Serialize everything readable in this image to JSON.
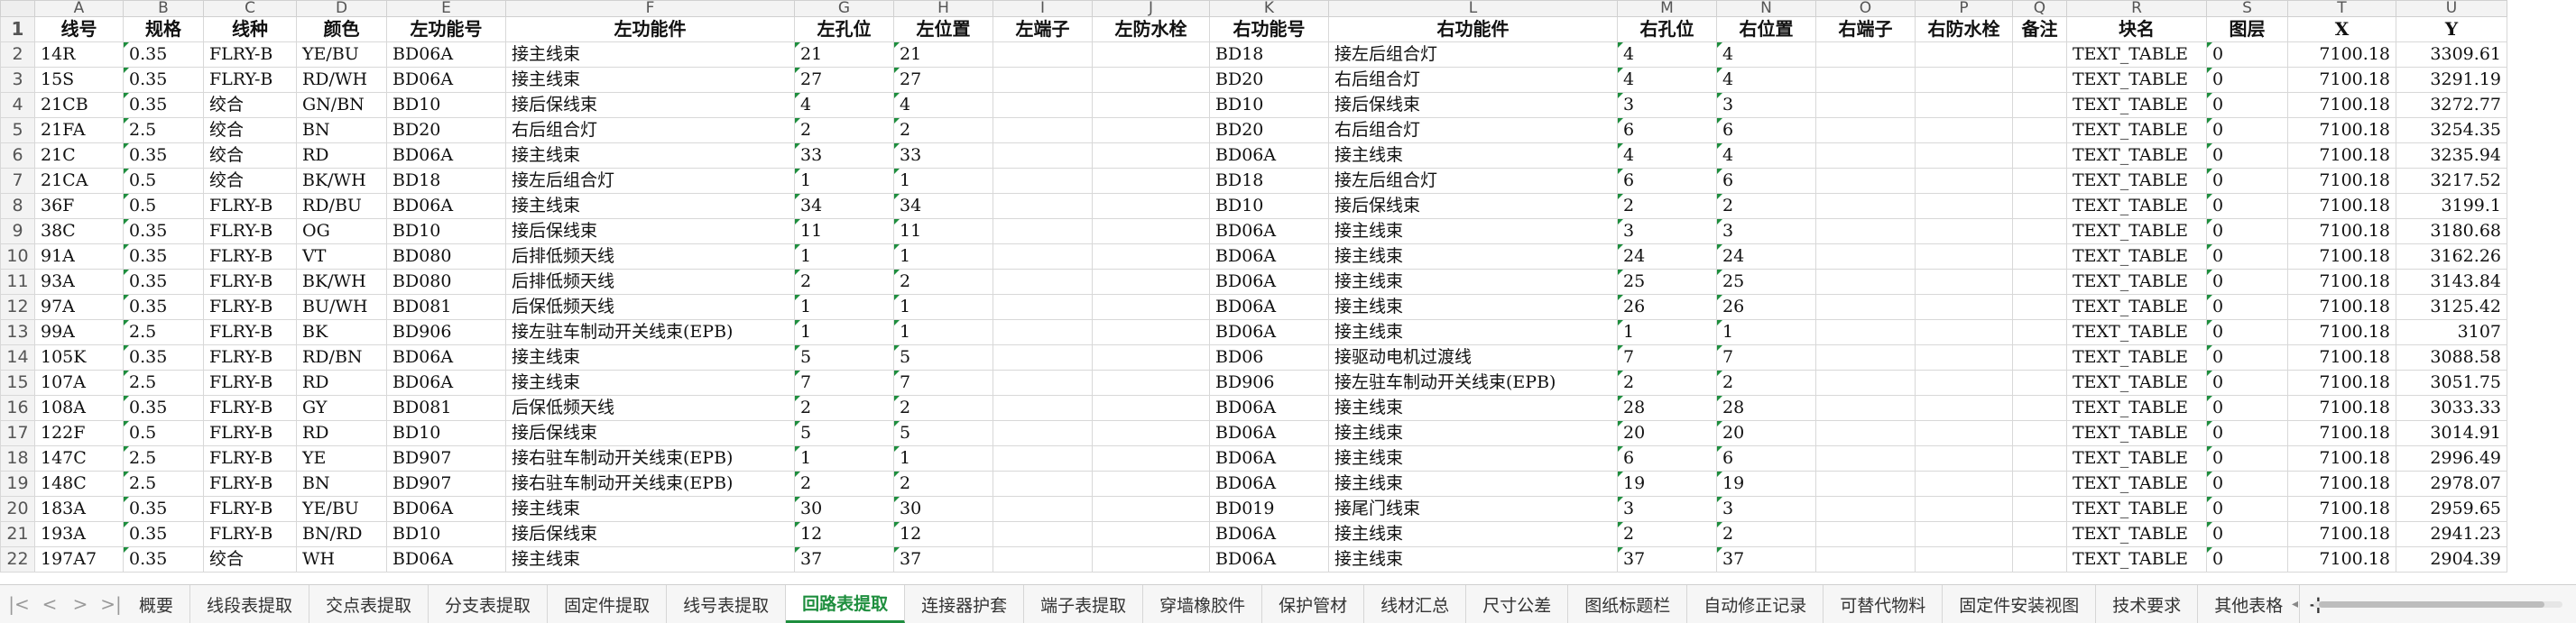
{
  "columns": [
    "A",
    "B",
    "C",
    "D",
    "E",
    "F",
    "G",
    "H",
    "I",
    "J",
    "K",
    "L",
    "M",
    "N",
    "O",
    "P",
    "Q",
    "R",
    "S",
    "T",
    "U"
  ],
  "headers": [
    "线号",
    "规格",
    "线种",
    "颜色",
    "左功能号",
    "左功能件",
    "左孔位",
    "左位置",
    "左端子",
    "左防水栓",
    "右功能号",
    "右功能件",
    "右孔位",
    "右位置",
    "右端子",
    "右防水栓",
    "备注",
    "块名",
    "图层",
    "X",
    "Y"
  ],
  "rows": [
    [
      "14R",
      "0.35",
      "FLRY-B",
      "YE/BU",
      "BD06A",
      "接主线束",
      "21",
      "21",
      "",
      "",
      "BD18",
      "接左后组合灯",
      "4",
      "4",
      "",
      "",
      "",
      "TEXT_TABLE",
      "0",
      "7100.18",
      "3309.61"
    ],
    [
      "15S",
      "0.35",
      "FLRY-B",
      "RD/WH",
      "BD06A",
      "接主线束",
      "27",
      "27",
      "",
      "",
      "BD20",
      "右后组合灯",
      "4",
      "4",
      "",
      "",
      "",
      "TEXT_TABLE",
      "0",
      "7100.18",
      "3291.19"
    ],
    [
      "21CB",
      "0.35",
      "绞合",
      "GN/BN",
      "BD10",
      "接后保线束",
      "4",
      "4",
      "",
      "",
      "BD10",
      "接后保线束",
      "3",
      "3",
      "",
      "",
      "",
      "TEXT_TABLE",
      "0",
      "7100.18",
      "3272.77"
    ],
    [
      "21FA",
      "2.5",
      "绞合",
      "BN",
      "BD20",
      "右后组合灯",
      "2",
      "2",
      "",
      "",
      "BD20",
      "右后组合灯",
      "6",
      "6",
      "",
      "",
      "",
      "TEXT_TABLE",
      "0",
      "7100.18",
      "3254.35"
    ],
    [
      "21C",
      "0.35",
      "绞合",
      "RD",
      "BD06A",
      "接主线束",
      "33",
      "33",
      "",
      "",
      "BD06A",
      "接主线束",
      "4",
      "4",
      "",
      "",
      "",
      "TEXT_TABLE",
      "0",
      "7100.18",
      "3235.94"
    ],
    [
      "21CA",
      "0.5",
      "绞合",
      "BK/WH",
      "BD18",
      "接左后组合灯",
      "1",
      "1",
      "",
      "",
      "BD18",
      "接左后组合灯",
      "6",
      "6",
      "",
      "",
      "",
      "TEXT_TABLE",
      "0",
      "7100.18",
      "3217.52"
    ],
    [
      "36F",
      "0.5",
      "FLRY-B",
      "RD/BU",
      "BD06A",
      "接主线束",
      "34",
      "34",
      "",
      "",
      "BD10",
      "接后保线束",
      "2",
      "2",
      "",
      "",
      "",
      "TEXT_TABLE",
      "0",
      "7100.18",
      "3199.1"
    ],
    [
      "38C",
      "0.35",
      "FLRY-B",
      "OG",
      "BD10",
      "接后保线束",
      "11",
      "11",
      "",
      "",
      "BD06A",
      "接主线束",
      "3",
      "3",
      "",
      "",
      "",
      "TEXT_TABLE",
      "0",
      "7100.18",
      "3180.68"
    ],
    [
      "91A",
      "0.35",
      "FLRY-B",
      "VT",
      "BD080",
      "后排低频天线",
      "1",
      "1",
      "",
      "",
      "BD06A",
      "接主线束",
      "24",
      "24",
      "",
      "",
      "",
      "TEXT_TABLE",
      "0",
      "7100.18",
      "3162.26"
    ],
    [
      "93A",
      "0.35",
      "FLRY-B",
      "BK/WH",
      "BD080",
      "后排低频天线",
      "2",
      "2",
      "",
      "",
      "BD06A",
      "接主线束",
      "25",
      "25",
      "",
      "",
      "",
      "TEXT_TABLE",
      "0",
      "7100.18",
      "3143.84"
    ],
    [
      "97A",
      "0.35",
      "FLRY-B",
      "BU/WH",
      "BD081",
      "后保低频天线",
      "1",
      "1",
      "",
      "",
      "BD06A",
      "接主线束",
      "26",
      "26",
      "",
      "",
      "",
      "TEXT_TABLE",
      "0",
      "7100.18",
      "3125.42"
    ],
    [
      "99A",
      "2.5",
      "FLRY-B",
      "BK",
      "BD906",
      "接左驻车制动开关线束(EPB)",
      "1",
      "1",
      "",
      "",
      "BD06A",
      "接主线束",
      "1",
      "1",
      "",
      "",
      "",
      "TEXT_TABLE",
      "0",
      "7100.18",
      "3107"
    ],
    [
      "105K",
      "0.35",
      "FLRY-B",
      "RD/BN",
      "BD06A",
      "接主线束",
      "5",
      "5",
      "",
      "",
      "BD06",
      "接驱动电机过渡线",
      "7",
      "7",
      "",
      "",
      "",
      "TEXT_TABLE",
      "0",
      "7100.18",
      "3088.58"
    ],
    [
      "107A",
      "2.5",
      "FLRY-B",
      "RD",
      "BD06A",
      "接主线束",
      "7",
      "7",
      "",
      "",
      "BD906",
      "接左驻车制动开关线束(EPB)",
      "2",
      "2",
      "",
      "",
      "",
      "TEXT_TABLE",
      "0",
      "7100.18",
      "3051.75"
    ],
    [
      "108A",
      "0.35",
      "FLRY-B",
      "GY",
      "BD081",
      "后保低频天线",
      "2",
      "2",
      "",
      "",
      "BD06A",
      "接主线束",
      "28",
      "28",
      "",
      "",
      "",
      "TEXT_TABLE",
      "0",
      "7100.18",
      "3033.33"
    ],
    [
      "122F",
      "0.5",
      "FLRY-B",
      "RD",
      "BD10",
      "接后保线束",
      "5",
      "5",
      "",
      "",
      "BD06A",
      "接主线束",
      "20",
      "20",
      "",
      "",
      "",
      "TEXT_TABLE",
      "0",
      "7100.18",
      "3014.91"
    ],
    [
      "147C",
      "2.5",
      "FLRY-B",
      "YE",
      "BD907",
      "接右驻车制动开关线束(EPB)",
      "1",
      "1",
      "",
      "",
      "BD06A",
      "接主线束",
      "6",
      "6",
      "",
      "",
      "",
      "TEXT_TABLE",
      "0",
      "7100.18",
      "2996.49"
    ],
    [
      "148C",
      "2.5",
      "FLRY-B",
      "BN",
      "BD907",
      "接右驻车制动开关线束(EPB)",
      "2",
      "2",
      "",
      "",
      "BD06A",
      "接主线束",
      "19",
      "19",
      "",
      "",
      "",
      "TEXT_TABLE",
      "0",
      "7100.18",
      "2978.07"
    ],
    [
      "183A",
      "0.35",
      "FLRY-B",
      "YE/BU",
      "BD06A",
      "接主线束",
      "30",
      "30",
      "",
      "",
      "BD019",
      "接尾门线束",
      "3",
      "3",
      "",
      "",
      "",
      "TEXT_TABLE",
      "0",
      "7100.18",
      "2959.65"
    ],
    [
      "193A",
      "0.35",
      "FLRY-B",
      "BN/RD",
      "BD10",
      "接后保线束",
      "12",
      "12",
      "",
      "",
      "BD06A",
      "接主线束",
      "2",
      "2",
      "",
      "",
      "",
      "TEXT_TABLE",
      "0",
      "7100.18",
      "2941.23"
    ],
    [
      "197A7",
      "0.35",
      "绞合",
      "WH",
      "BD06A",
      "接主线束",
      "37",
      "37",
      "",
      "",
      "BD06A",
      "接主线束",
      "37",
      "37",
      "",
      "",
      "",
      "TEXT_TABLE",
      "0",
      "7100.18",
      "2904.39"
    ]
  ],
  "tabs": [
    "概要",
    "线段表提取",
    "交点表提取",
    "分支表提取",
    "固定件提取",
    "线号表提取",
    "回路表提取",
    "连接器护套",
    "端子表提取",
    "穿墙橡胶件",
    "保护管材",
    "线材汇总",
    "尺寸公差",
    "图纸标题栏",
    "自动修正记录",
    "可替代物料",
    "固定件安装视图",
    "技术要求",
    "其他表格"
  ],
  "active_tab": "回路表提取",
  "add_tab_symbol": "+",
  "nav_symbols": [
    "|<",
    "<",
    ">",
    ">|"
  ],
  "accent_color": "#1e8e3e"
}
